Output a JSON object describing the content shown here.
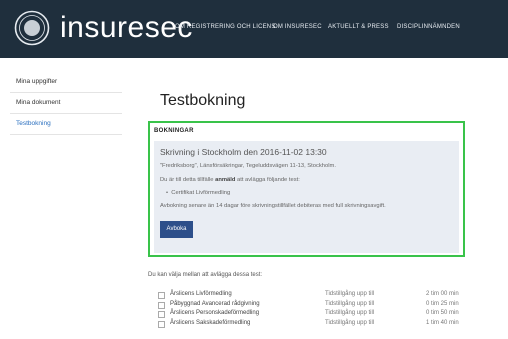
{
  "header": {
    "brand": "insuresec",
    "nav": [
      "OM REGISTRERING OCH LICENS",
      "OM INSURESEC",
      "AKTUELLT & PRESS",
      "DISCIPLINNÄMNDEN"
    ]
  },
  "sidebar": {
    "items": [
      {
        "label": "Mina uppgifter"
      },
      {
        "label": "Mina dokument"
      },
      {
        "label": "Testbokning"
      }
    ]
  },
  "main": {
    "title": "Testbokning",
    "bookings": {
      "heading": "BOKNINGAR",
      "event_title": "Skrivning i Stockholm den 2016-11-02 13:30",
      "location": "\"Fredriksborg\", Länsförsäkringar, Tegeluddsvägen 11-13, Stockholm.",
      "registered_pre": "Du är till detta tillfälle ",
      "registered_bold": "anmäld",
      "registered_post": " att avlägga följande test:",
      "tests": [
        "Certifikat Livförmedling"
      ],
      "cancellation_note": "Avbokning senare än 14 dagar före skrivningstillfället debiteras med full skrivningsavgift.",
      "cancel_button": "Avboka"
    },
    "choose_intro": "Du kan välja mellan att avlägga dessa test:",
    "available_tests": [
      {
        "name": "Årslicens Livförmedling",
        "availability": "Tidstillgång upp till",
        "duration": "2 tim 00 min"
      },
      {
        "name": "Påbyggnad Avancerad rådgivning",
        "availability": "Tidstillgång upp till",
        "duration": "0 tim 25 min"
      },
      {
        "name": "Årslicens Personskadeförmedling",
        "availability": "Tidstillgång upp till",
        "duration": "0 tim 50 min"
      },
      {
        "name": "Årslicens Sakskadeförmedling",
        "availability": "Tidstillgång upp till",
        "duration": "1 tim 40 min"
      }
    ]
  }
}
